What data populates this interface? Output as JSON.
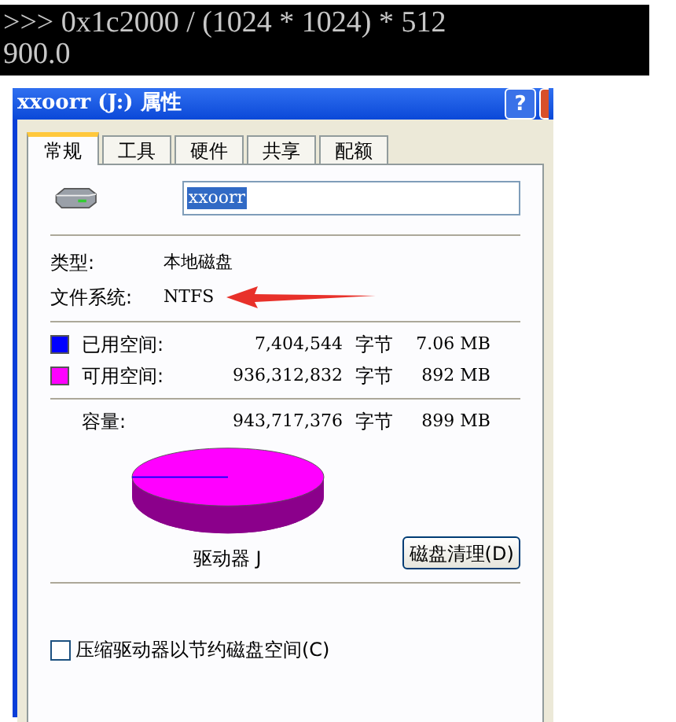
{
  "terminal": {
    "lines": [
      ">>> 0x1c2000 / (1024 * 1024) * 512",
      "900.0"
    ]
  },
  "window": {
    "title": "xxoorr (J:) 属性",
    "help_button": "?"
  },
  "tabs": [
    {
      "label": "常规",
      "selected": true
    },
    {
      "label": "工具",
      "selected": false
    },
    {
      "label": "硬件",
      "selected": false
    },
    {
      "label": "共享",
      "selected": false
    },
    {
      "label": "配额",
      "selected": false
    }
  ],
  "name_field": {
    "value": "xxoorr"
  },
  "info": [
    {
      "label": "类型:",
      "value": "本地磁盘"
    },
    {
      "label": "文件系统:",
      "value": "NTFS",
      "arrow": true
    }
  ],
  "space": [
    {
      "label": "已用空间:",
      "bytes": "7,404,544",
      "unit": "字节",
      "size": "7.06 MB",
      "color": "#0000ff"
    },
    {
      "label": "可用空间:",
      "bytes": "936,312,832",
      "unit": "字节",
      "size": "892 MB",
      "color": "#ff00ff"
    }
  ],
  "capacity": {
    "label": "容量:",
    "bytes": "943,717,376",
    "unit": "字节",
    "size": "899 MB"
  },
  "drive_label": "驱动器 J",
  "cleanup_button": "磁盘清理(D)",
  "compress": {
    "label": "压缩驱动器以节约磁盘空间(C)",
    "checked": false
  }
}
